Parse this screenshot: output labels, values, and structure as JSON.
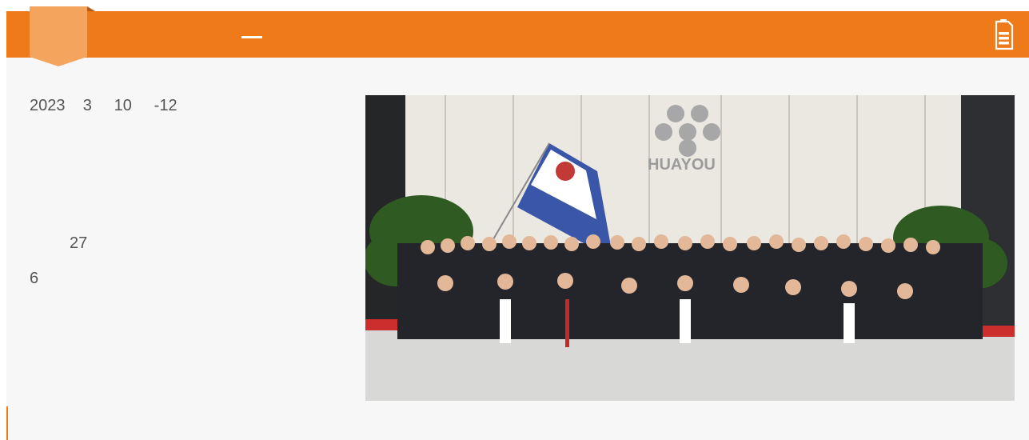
{
  "header": {
    "title_dash": "—",
    "icon": "document-icon",
    "bookmark_icon": "bookmark-ribbon-icon"
  },
  "article": {
    "date_line": "2023    3     10     -12",
    "count_line": "         27",
    "six_line": "6"
  },
  "photo": {
    "logo_text": "HUAYOU"
  },
  "colors": {
    "accent": "#ee7a1a",
    "ribbon": "#f4a45c",
    "background": "#f7f7f7"
  }
}
